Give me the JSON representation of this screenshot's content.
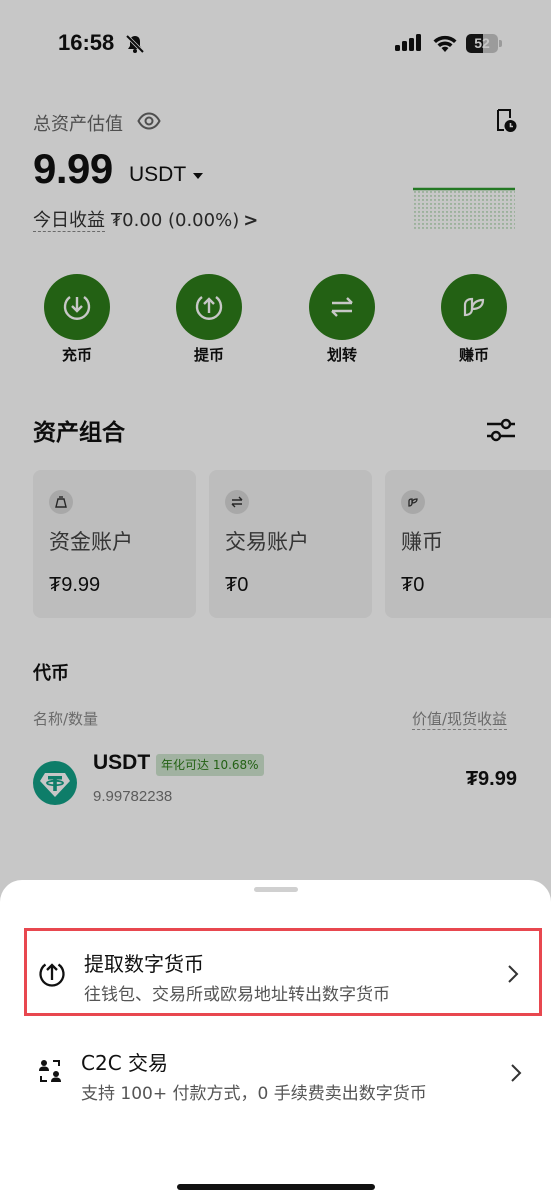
{
  "status_bar": {
    "time": "16:58",
    "battery": "52"
  },
  "header": {
    "total_label": "总资产估值",
    "balance": "9.99",
    "currency": "USDT",
    "pnl_label": "今日收益",
    "pnl_value": "₮0.00 (0.00%)",
    "pnl_arrow": ">"
  },
  "actions": [
    {
      "label": "充币",
      "icon": "deposit-icon"
    },
    {
      "label": "提币",
      "icon": "withdraw-icon"
    },
    {
      "label": "划转",
      "icon": "transfer-icon"
    },
    {
      "label": "赚币",
      "icon": "earn-icon"
    }
  ],
  "portfolio": {
    "title": "资产组合",
    "cards": [
      {
        "name": "资金账户",
        "amount": "₮9.99",
        "icon": "wallet-bag-icon"
      },
      {
        "name": "交易账户",
        "amount": "₮0",
        "icon": "swap-icon"
      },
      {
        "name": "赚币",
        "amount": "₮0",
        "icon": "earn-icon"
      }
    ]
  },
  "tokens": {
    "title": "代币",
    "col_left": "名称/数量",
    "col_right": "价值/现货收益",
    "items": [
      {
        "name": "USDT",
        "badge": "年化可达 10.68%",
        "qty": "9.99782238",
        "value": "₮9.99",
        "icon": "tether-icon"
      }
    ]
  },
  "sheet": {
    "options": [
      {
        "title": "提取数字货币",
        "subtitle": "往钱包、交易所或欧易地址转出数字货币",
        "icon": "upload-circle-icon"
      },
      {
        "title": "C2C 交易",
        "subtitle": "支持 100+ 付款方式，0 手续费卖出数字货币",
        "icon": "c2c-icon"
      }
    ]
  },
  "colors": {
    "accent": "#2e7d1a",
    "highlight": "#e8474f",
    "badge_bg": "#cfe4cf"
  }
}
